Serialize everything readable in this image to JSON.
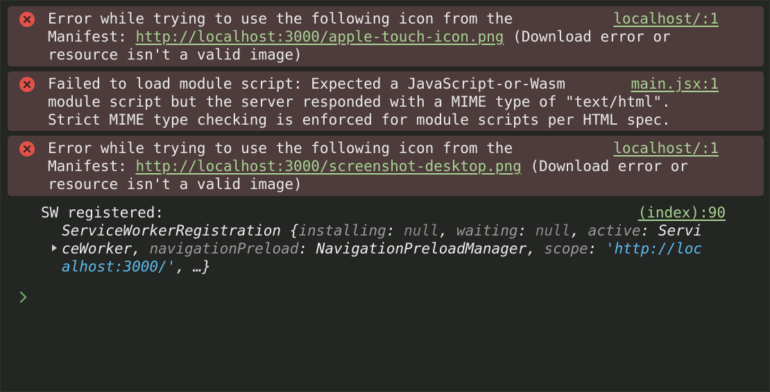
{
  "messages": [
    {
      "lines": [
        {
          "text": "Error while trying to use the following icon from the"
        },
        {
          "prefix": "Manifest: ",
          "link": "http://localhost:3000/apple-touch-icon.png",
          "suffix": " (Download error or"
        },
        {
          "text": "resource isn't a valid image)"
        }
      ],
      "source": "localhost/:1"
    },
    {
      "lines": [
        {
          "text": "Failed to load module script: Expected a JavaScript-or-Wasm"
        },
        {
          "text": "module script but the server responded with a MIME type of \"text/html\"."
        },
        {
          "text": "Strict MIME type checking is enforced for module scripts per HTML spec."
        }
      ],
      "source": "main.jsx:1"
    },
    {
      "lines": [
        {
          "text": "Error while trying to use the following icon from the"
        },
        {
          "prefix": "Manifest: ",
          "link": "http://localhost:3000/screenshot-desktop.png",
          "suffix": " (Download error or"
        },
        {
          "text": "resource isn't a valid image)"
        }
      ],
      "source": "localhost/:1"
    }
  ],
  "log": {
    "text": "SW registered:",
    "source": "(index):90",
    "object": {
      "class_name": "ServiceWorkerRegistration",
      "open_brace": " {",
      "k1": "installing",
      "v1": "null",
      "k2": "waiting",
      "v2": "null",
      "k3": "active",
      "v3a": "Servi",
      "v3b": "ceWorker",
      "k4": "navigationPreload",
      "v4": "NavigationPreloadManager",
      "k5": "scope",
      "v5a": "'http://loc",
      "v5b": "alhost:3000/'",
      "tail": ", …}"
    }
  },
  "colors": {
    "error_bg": "#4e3c3c",
    "error_icon": "#e4524b",
    "link": "#a8d392",
    "string": "#5dbbf0",
    "background": "#242623",
    "prompt": "#6fb36f"
  },
  "icons": {
    "error": "close-circle-icon",
    "expand": "triangle-right-icon",
    "prompt": "chevron-right-icon"
  }
}
